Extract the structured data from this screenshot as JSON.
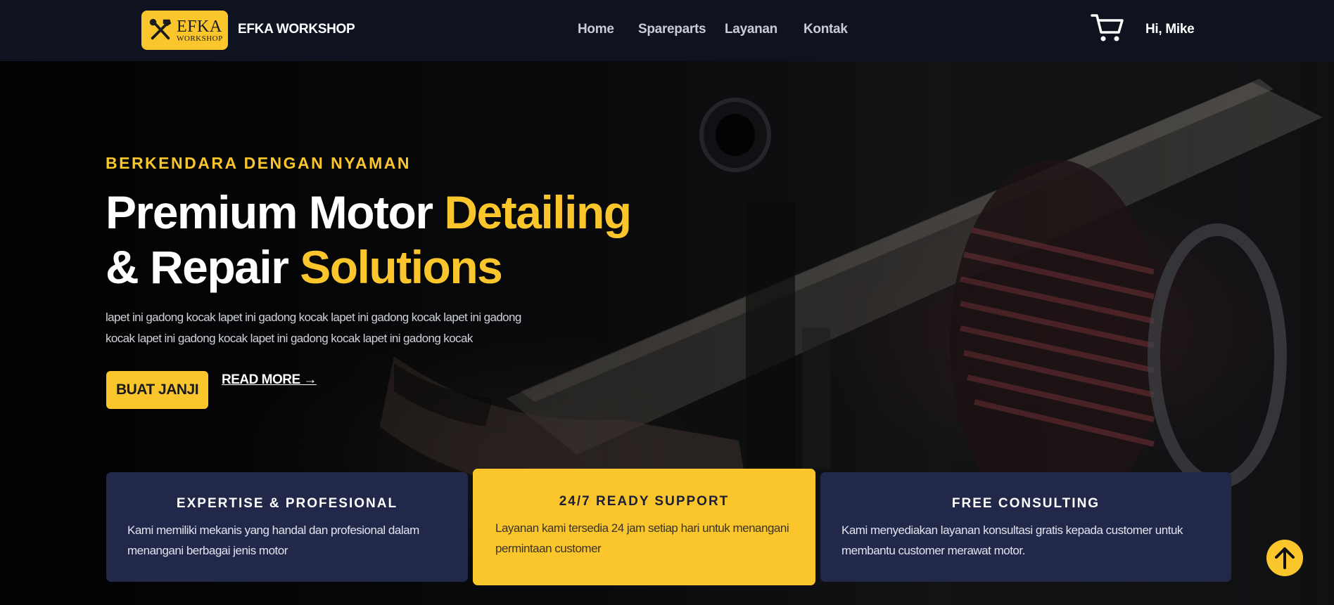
{
  "nav": {
    "logo_line1": "EFKA",
    "logo_line2": "WORKSHOP",
    "brand": "EFKA WORKSHOP",
    "links": [
      "Home",
      "Spareparts",
      "Layanan",
      "Kontak"
    ],
    "cart_icon": "shopping-cart-icon",
    "greeting": "Hi, Mike"
  },
  "hero": {
    "kicker": "BERKENDARA DENGAN NYAMAN",
    "headline_part1": "Premium Motor ",
    "headline_accent1": "Detailing",
    "headline_part2": "& Repair ",
    "headline_accent2": "Solutions",
    "description": "lapet ini gadong kocak lapet ini gadong kocak lapet ini gadong kocak lapet ini gadong kocak lapet ini gadong kocak lapet ini gadong kocak lapet ini gadong kocak",
    "primary_button": "BUAT JANJI",
    "secondary_link": "READ MORE →"
  },
  "features": [
    {
      "title": "EXPERTISE & PROFESIONAL",
      "text": "Kami memiliki mekanis yang handal dan profesional dalam menangani berbagai jenis motor"
    },
    {
      "title": "24/7 READY SUPPORT",
      "text": "Layanan kami tersedia 24 jam setiap hari untuk menangani permintaan customer"
    },
    {
      "title": "FREE CONSULTING",
      "text": "Kami menyediakan layanan konsultasi gratis kepada customer untuk membantu customer merawat motor."
    }
  ],
  "colors": {
    "accent": "#fbc52c",
    "navbar": "#0f131f",
    "card_dark": "#22284a"
  },
  "scroll_top_icon": "arrow-up-icon"
}
